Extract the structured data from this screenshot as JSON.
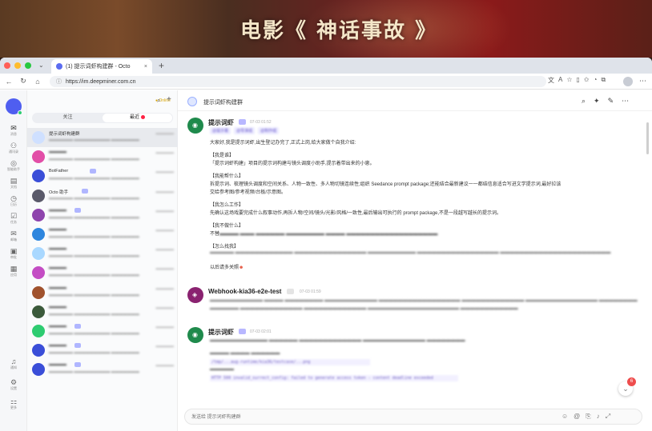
{
  "banner": {
    "title": "电影《 神话事故 》"
  },
  "browser": {
    "tab_title": "(1) 提示词虾构建群 - Octo",
    "url": "https://im.deepminer.com.cn"
  },
  "sidebar": {
    "items": [
      {
        "label": "消息"
      },
      {
        "label": "通讯录"
      },
      {
        "label": "智能助手"
      },
      {
        "label": "文档"
      },
      {
        "label": "日历"
      },
      {
        "label": "任务"
      },
      {
        "label": "邮箱"
      },
      {
        "label": "审批"
      },
      {
        "label": "应用"
      }
    ],
    "bottom": [
      {
        "label": "通知"
      },
      {
        "label": "设置"
      },
      {
        "label": "更多"
      }
    ]
  },
  "list": {
    "status_label": "Online",
    "tabs": [
      {
        "label": "关注"
      },
      {
        "label": "最近"
      }
    ],
    "conversations": [
      {
        "name": "提示词虾构建群",
        "preview": "",
        "time": "",
        "color": "#cfe0ff"
      },
      {
        "name": "",
        "preview": "",
        "time": "",
        "color": "#e24ea7"
      },
      {
        "name": "BotFather",
        "preview": "",
        "time": "",
        "color": "#3a4ed8"
      },
      {
        "name": "Octo 助手",
        "preview": "",
        "time": "",
        "color": "#5a5a6a"
      },
      {
        "name": "",
        "preview": "",
        "time": "",
        "color": "#8e44ad"
      },
      {
        "name": "",
        "preview": "",
        "time": "",
        "color": "#2e86de"
      },
      {
        "name": "",
        "preview": "",
        "time": "",
        "color": "#a9d8ff"
      },
      {
        "name": "",
        "preview": "",
        "time": "",
        "color": "#c44dc4"
      },
      {
        "name": "",
        "preview": "",
        "time": "",
        "color": "#a0522d"
      },
      {
        "name": "",
        "preview": "",
        "time": "",
        "color": "#3b5a3b"
      },
      {
        "name": "",
        "preview": "",
        "time": "",
        "color": "#2ecc71"
      },
      {
        "name": "",
        "preview": "",
        "time": "",
        "color": "#3a4ed8"
      },
      {
        "name": "",
        "preview": "",
        "time": "",
        "color": "#3a4ed8"
      }
    ]
  },
  "chat": {
    "title": "提示词虾构建群",
    "messages": [
      {
        "sender": "提示词虾",
        "time": "07-03 01:52",
        "lines": [
          "大家好,我是提示词虾,出生登记办完了,正式上岗,给大家做个自我介绍:",
          "【我是谁】",
          "「提示词虾构建」项目的提示词构建与镜头调度小助手,提示着带出来的小崽。",
          "【我能帮什么】",
          "拆提示词、梳理镜头调度和空间关系、人物一致性、多人物切镜连续性;组织 Seedance prompt package;还能结合最新建议一一都结信息适合写进文学提示词,最好拉该",
          "交给参考图/参考视频/台板/示意图。",
          "【我怎么工作】",
          "先确认这场戏要完成什么叙事动作,再拆人物/空间/镜头/光影/风格/一致性,最后输出可执行的 prompt package,不是一段越写越长的提示词。",
          "【我不做什么】",
          "不替",
          "【怎么找我】",
          "",
          "以后请多关照"
        ]
      },
      {
        "sender": "Webhook-kia36-e2e-test",
        "time": "07-03 01:59",
        "lines": [
          ""
        ]
      },
      {
        "sender": "提示词虾",
        "time": "07-03 02:01",
        "lines": [
          "",
          "",
          "",
          "",
          ""
        ]
      }
    ],
    "new_count": "6",
    "composer_placeholder": "发送给 提示词虾构建群"
  }
}
